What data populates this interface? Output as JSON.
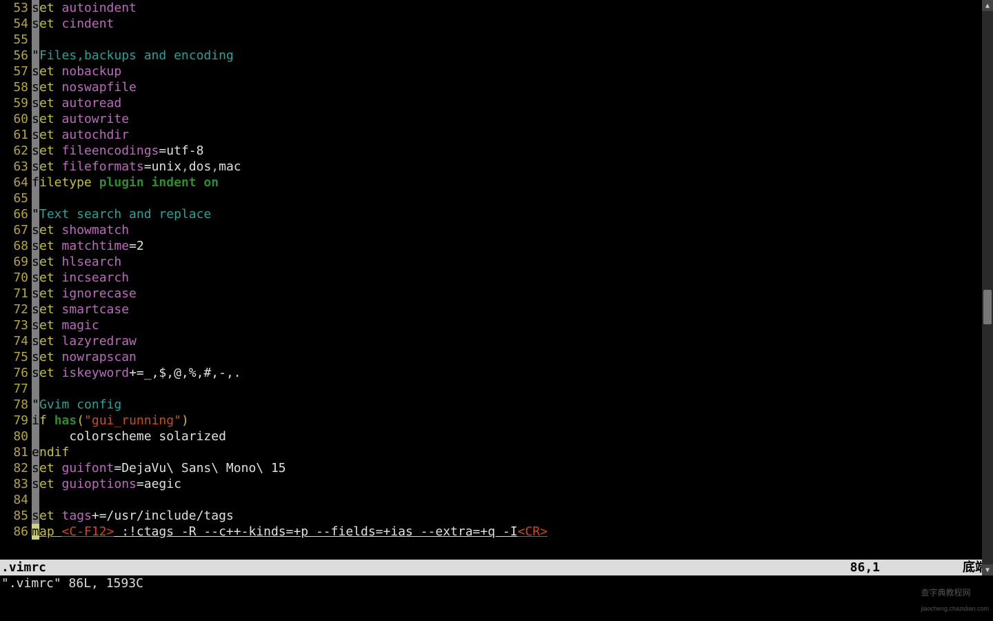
{
  "lines": [
    {
      "n": "53",
      "t": [
        {
          "c": "col0",
          "s": "s"
        },
        {
          "c": "kw",
          "s": "et "
        },
        {
          "c": "opt",
          "s": "autoindent"
        }
      ]
    },
    {
      "n": "54",
      "t": [
        {
          "c": "col0",
          "s": "s"
        },
        {
          "c": "kw",
          "s": "et "
        },
        {
          "c": "opt",
          "s": "cindent"
        }
      ]
    },
    {
      "n": "55",
      "t": [
        {
          "c": "col0",
          "s": " "
        }
      ]
    },
    {
      "n": "56",
      "t": [
        {
          "c": "col0",
          "s": "\""
        },
        {
          "c": "cmt",
          "s": "Files,backups and encoding"
        }
      ]
    },
    {
      "n": "57",
      "t": [
        {
          "c": "col0",
          "s": "s"
        },
        {
          "c": "kw",
          "s": "et "
        },
        {
          "c": "opt",
          "s": "nobackup"
        }
      ]
    },
    {
      "n": "58",
      "t": [
        {
          "c": "col0",
          "s": "s"
        },
        {
          "c": "kw",
          "s": "et "
        },
        {
          "c": "opt",
          "s": "noswapfile"
        }
      ]
    },
    {
      "n": "59",
      "t": [
        {
          "c": "col0",
          "s": "s"
        },
        {
          "c": "kw",
          "s": "et "
        },
        {
          "c": "opt",
          "s": "autoread"
        }
      ]
    },
    {
      "n": "60",
      "t": [
        {
          "c": "col0",
          "s": "s"
        },
        {
          "c": "kw",
          "s": "et "
        },
        {
          "c": "opt",
          "s": "autowrite"
        }
      ]
    },
    {
      "n": "61",
      "t": [
        {
          "c": "col0",
          "s": "s"
        },
        {
          "c": "kw",
          "s": "et "
        },
        {
          "c": "opt",
          "s": "autochdir"
        }
      ]
    },
    {
      "n": "62",
      "t": [
        {
          "c": "col0",
          "s": "s"
        },
        {
          "c": "kw",
          "s": "et "
        },
        {
          "c": "opt",
          "s": "fileencodings"
        },
        {
          "c": "white",
          "s": "=utf-8"
        }
      ]
    },
    {
      "n": "63",
      "t": [
        {
          "c": "col0",
          "s": "s"
        },
        {
          "c": "kw",
          "s": "et "
        },
        {
          "c": "opt",
          "s": "fileformats"
        },
        {
          "c": "white",
          "s": "=unix"
        },
        {
          "c": "kw",
          "s": ","
        },
        {
          "c": "white",
          "s": "dos"
        },
        {
          "c": "kw",
          "s": ","
        },
        {
          "c": "white",
          "s": "mac"
        }
      ]
    },
    {
      "n": "64",
      "t": [
        {
          "c": "col0",
          "s": "f"
        },
        {
          "c": "kw",
          "s": "iletype "
        },
        {
          "c": "func",
          "s": "plugin indent on"
        }
      ]
    },
    {
      "n": "65",
      "t": [
        {
          "c": "col0",
          "s": " "
        }
      ]
    },
    {
      "n": "66",
      "t": [
        {
          "c": "col0",
          "s": "\""
        },
        {
          "c": "cmt",
          "s": "Text search and replace"
        }
      ]
    },
    {
      "n": "67",
      "t": [
        {
          "c": "col0",
          "s": "s"
        },
        {
          "c": "kw",
          "s": "et "
        },
        {
          "c": "opt",
          "s": "showmatch"
        }
      ]
    },
    {
      "n": "68",
      "t": [
        {
          "c": "col0",
          "s": "s"
        },
        {
          "c": "kw",
          "s": "et "
        },
        {
          "c": "opt",
          "s": "matchtime"
        },
        {
          "c": "white",
          "s": "=2"
        }
      ]
    },
    {
      "n": "69",
      "t": [
        {
          "c": "col0",
          "s": "s"
        },
        {
          "c": "kw",
          "s": "et "
        },
        {
          "c": "opt",
          "s": "hlsearch"
        }
      ]
    },
    {
      "n": "70",
      "t": [
        {
          "c": "col0",
          "s": "s"
        },
        {
          "c": "kw",
          "s": "et "
        },
        {
          "c": "opt",
          "s": "incsearch"
        }
      ]
    },
    {
      "n": "71",
      "t": [
        {
          "c": "col0",
          "s": "s"
        },
        {
          "c": "kw",
          "s": "et "
        },
        {
          "c": "opt",
          "s": "ignorecase"
        }
      ]
    },
    {
      "n": "72",
      "t": [
        {
          "c": "col0",
          "s": "s"
        },
        {
          "c": "kw",
          "s": "et "
        },
        {
          "c": "opt",
          "s": "smartcase"
        }
      ]
    },
    {
      "n": "73",
      "t": [
        {
          "c": "col0",
          "s": "s"
        },
        {
          "c": "kw",
          "s": "et "
        },
        {
          "c": "opt",
          "s": "magic"
        }
      ]
    },
    {
      "n": "74",
      "t": [
        {
          "c": "col0",
          "s": "s"
        },
        {
          "c": "kw",
          "s": "et "
        },
        {
          "c": "opt",
          "s": "lazyredraw"
        }
      ]
    },
    {
      "n": "75",
      "t": [
        {
          "c": "col0",
          "s": "s"
        },
        {
          "c": "kw",
          "s": "et "
        },
        {
          "c": "opt",
          "s": "nowrapscan"
        }
      ]
    },
    {
      "n": "76",
      "t": [
        {
          "c": "col0",
          "s": "s"
        },
        {
          "c": "kw",
          "s": "et "
        },
        {
          "c": "opt",
          "s": "iskeyword"
        },
        {
          "c": "white",
          "s": "+=_,$,@,%,#,-,."
        }
      ]
    },
    {
      "n": "77",
      "t": [
        {
          "c": "col0",
          "s": " "
        }
      ]
    },
    {
      "n": "78",
      "t": [
        {
          "c": "col0",
          "s": "\""
        },
        {
          "c": "cmt",
          "s": "Gvim config"
        }
      ]
    },
    {
      "n": "79",
      "t": [
        {
          "c": "col0",
          "s": "i"
        },
        {
          "c": "kw",
          "s": "f "
        },
        {
          "c": "func",
          "s": "has"
        },
        {
          "c": "kw",
          "s": "("
        },
        {
          "c": "str",
          "s": "\"gui_running\""
        },
        {
          "c": "kw",
          "s": ")"
        }
      ]
    },
    {
      "n": "80",
      "t": [
        {
          "c": "col0",
          "s": " "
        },
        {
          "c": "white",
          "s": "    colorscheme solarized"
        }
      ]
    },
    {
      "n": "81",
      "t": [
        {
          "c": "col0",
          "s": "e"
        },
        {
          "c": "kw",
          "s": "ndif"
        }
      ]
    },
    {
      "n": "82",
      "t": [
        {
          "c": "col0",
          "s": "s"
        },
        {
          "c": "kw",
          "s": "et "
        },
        {
          "c": "opt",
          "s": "guifont"
        },
        {
          "c": "white",
          "s": "=DejaVu\\ Sans\\ Mono\\ 15"
        }
      ]
    },
    {
      "n": "83",
      "t": [
        {
          "c": "col0",
          "s": "s"
        },
        {
          "c": "kw",
          "s": "et "
        },
        {
          "c": "opt",
          "s": "guioptions"
        },
        {
          "c": "white",
          "s": "=aegic"
        }
      ]
    },
    {
      "n": "84",
      "t": [
        {
          "c": "col0",
          "s": " "
        }
      ]
    },
    {
      "n": "85",
      "t": [
        {
          "c": "col0",
          "s": "s"
        },
        {
          "c": "kw",
          "s": "et "
        },
        {
          "c": "opt",
          "s": "tags"
        },
        {
          "c": "white",
          "s": "+=/usr/include/tags"
        }
      ]
    },
    {
      "n": "86",
      "cursor": true,
      "t": [
        {
          "c": "col0 cursor",
          "s": "m"
        },
        {
          "c": "kw underline",
          "s": "ap "
        },
        {
          "c": "sp underline",
          "s": "<C-F12>"
        },
        {
          "c": "white underline",
          "s": " :!ctags -R --c++-kinds=+p --fields=+ias --extra=+q -I"
        },
        {
          "c": "sp underline",
          "s": "<CR>"
        }
      ]
    }
  ],
  "status": {
    "filename": ".vimrc",
    "ruler": "86,1",
    "pos": "底端"
  },
  "cmdline": "\".vimrc\" 86L, 1593C",
  "watermark": {
    "main": "查字典教程网",
    "sub": "jiaocheng.chazidian.com"
  }
}
